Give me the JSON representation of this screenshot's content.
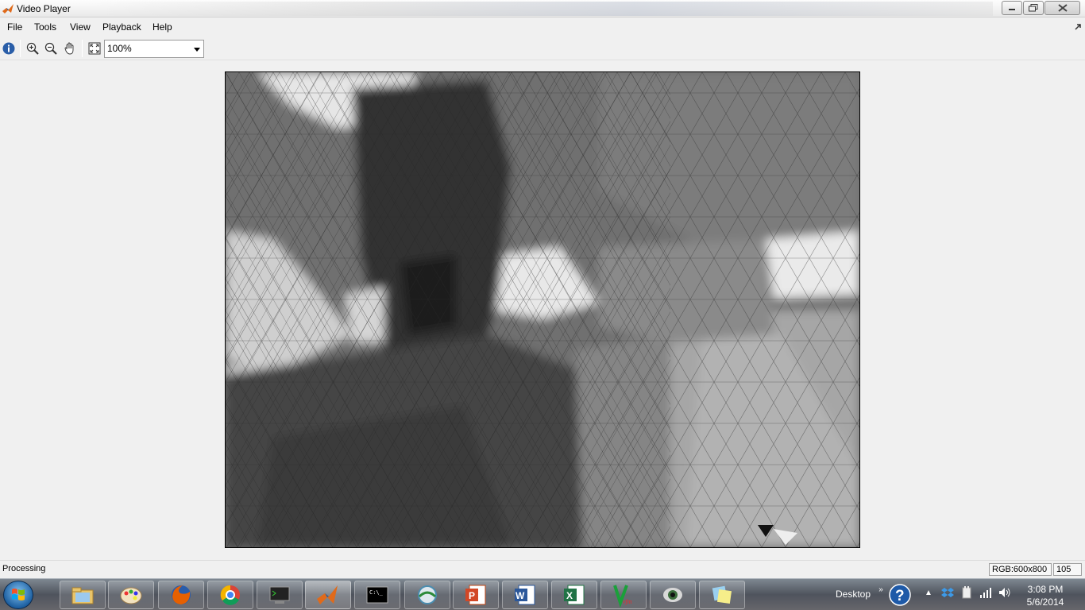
{
  "window": {
    "title": "Video Player"
  },
  "menu": [
    "File",
    "Tools",
    "View",
    "Playback",
    "Help"
  ],
  "toolbar": {
    "zoom_value": "100%"
  },
  "status": {
    "text": "Processing",
    "rgb_info": "RGB:600x800",
    "frame_number": "105"
  },
  "taskbar": {
    "items": [
      "windows-explorer",
      "paint",
      "firefox",
      "chrome",
      "terminal",
      "matlab",
      "command-prompt",
      "network",
      "powerpoint",
      "word",
      "excel",
      "vfm",
      "eye-app",
      "sticky-notes"
    ],
    "active_item": "matlab",
    "desktop_label": "Desktop",
    "time": "3:08 PM",
    "date": "5/6/2014"
  },
  "colors": {
    "window_bg": "#f0f0f0",
    "taskbar": "#4a4f57",
    "frame_border": "#000000"
  }
}
